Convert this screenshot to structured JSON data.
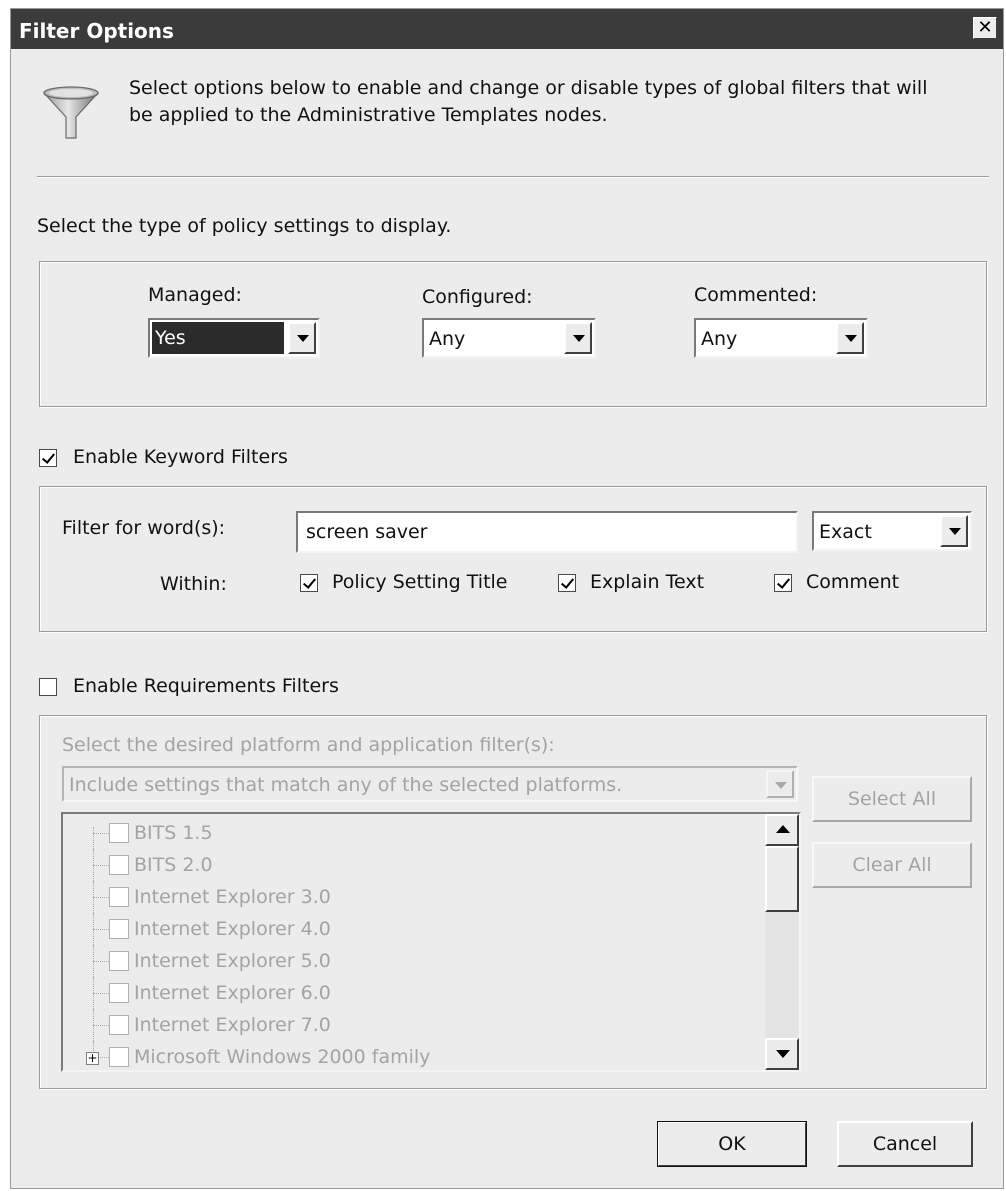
{
  "window": {
    "title": "Filter Options",
    "close_label": "✕"
  },
  "intro": {
    "icon": "funnel-icon",
    "text": "Select options below to enable and change or disable types of global filters that will be applied to the Administrative Templates nodes."
  },
  "policy_type": {
    "label": "Select the type of policy settings to display.",
    "managed": {
      "label": "Managed:",
      "value": "Yes"
    },
    "configured": {
      "label": "Configured:",
      "value": "Any"
    },
    "commented": {
      "label": "Commented:",
      "value": "Any"
    }
  },
  "keyword": {
    "enable_label": "Enable Keyword Filters",
    "enabled": true,
    "filter_label": "Filter for word(s):",
    "filter_value": "screen saver",
    "match_value": "Exact",
    "within_label": "Within:",
    "within": [
      {
        "label": "Policy Setting Title",
        "checked": true
      },
      {
        "label": "Explain Text",
        "checked": true
      },
      {
        "label": "Comment",
        "checked": true
      }
    ]
  },
  "requirements": {
    "enable_label": "Enable Requirements Filters",
    "enabled": false,
    "platform_label": "Select the desired platform and application filter(s):",
    "include_value": "Include settings that match any of the selected platforms.",
    "select_all": "Select All",
    "clear_all": "Clear All",
    "platforms": [
      "BITS 1.5",
      "BITS 2.0",
      "Internet Explorer 3.0",
      "Internet Explorer 4.0",
      "Internet Explorer 5.0",
      "Internet Explorer 6.0",
      "Internet Explorer 7.0",
      "Microsoft Windows 2000 family"
    ]
  },
  "footer": {
    "ok": "OK",
    "cancel": "Cancel"
  }
}
